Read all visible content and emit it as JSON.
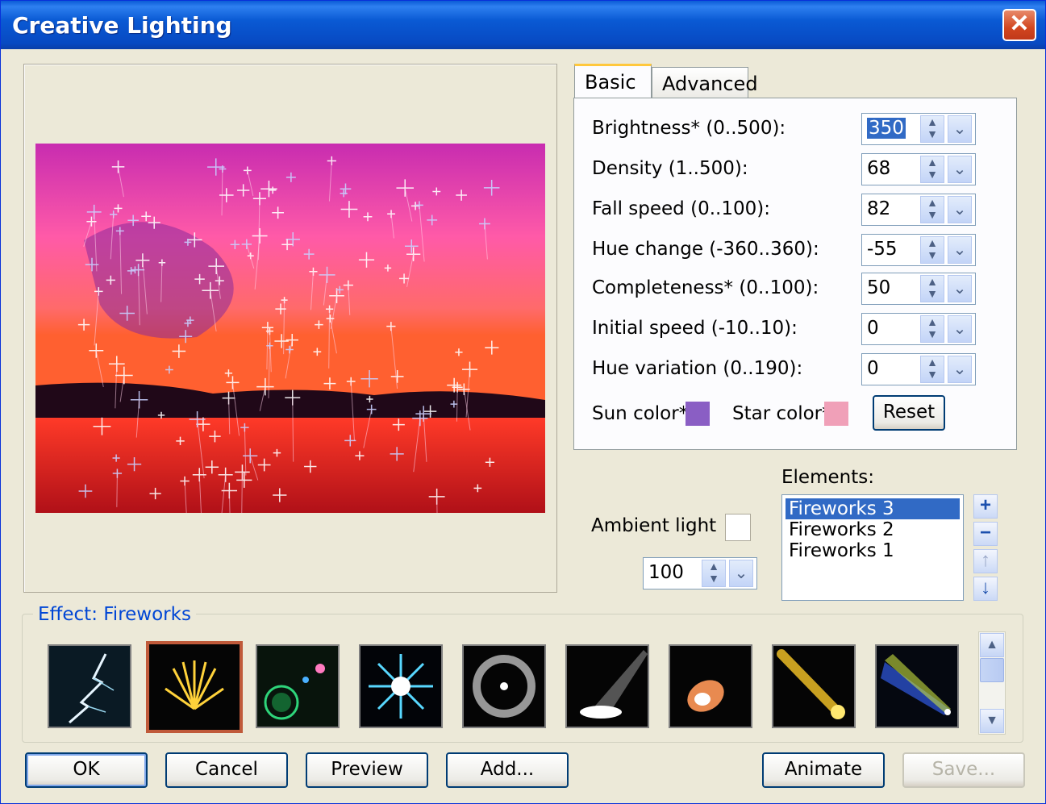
{
  "window": {
    "title": "Creative Lighting"
  },
  "tabs": [
    {
      "label": "Basic"
    },
    {
      "label": "Advanced"
    }
  ],
  "params": [
    {
      "label": "Brightness* (0..500):",
      "value": "350"
    },
    {
      "label": "Density (1..500):",
      "value": "68"
    },
    {
      "label": "Fall speed (0..100):",
      "value": "82"
    },
    {
      "label": "Hue change (-360..360):",
      "value": "-55"
    },
    {
      "label": "Completeness* (0..100):",
      "value": "50"
    },
    {
      "label": "Initial speed (-10..10):",
      "value": "0"
    },
    {
      "label": "Hue variation (0..190):",
      "value": "0"
    }
  ],
  "colors": {
    "sun_label": "Sun color*",
    "sun": "#8a5ec4",
    "star_label": "Star color*",
    "star": "#f0a0b8",
    "reset_label": "Reset"
  },
  "ambient": {
    "label": "Ambient light",
    "value": "100",
    "color": "#ffffff"
  },
  "elements": {
    "label": "Elements:",
    "items": [
      "Fireworks 3",
      "Fireworks 2",
      "Fireworks 1"
    ],
    "selected": "Fireworks 3"
  },
  "effect": {
    "title": "Effect: Fireworks",
    "thumbnails": [
      "lightning-thumbnail",
      "fireworks-thumbnail",
      "lens-flare-thumbnail",
      "star-burst-thumbnail",
      "halo-ring-thumbnail",
      "spotlight-thumbnail",
      "glow-orb-thumbnail",
      "comet-thumbnail",
      "light-beam-thumbnail"
    ],
    "selected": "fireworks-thumbnail"
  },
  "buttons": {
    "ok": "OK",
    "cancel": "Cancel",
    "preview": "Preview",
    "add": "Add...",
    "animate": "Animate",
    "save": "Save..."
  }
}
